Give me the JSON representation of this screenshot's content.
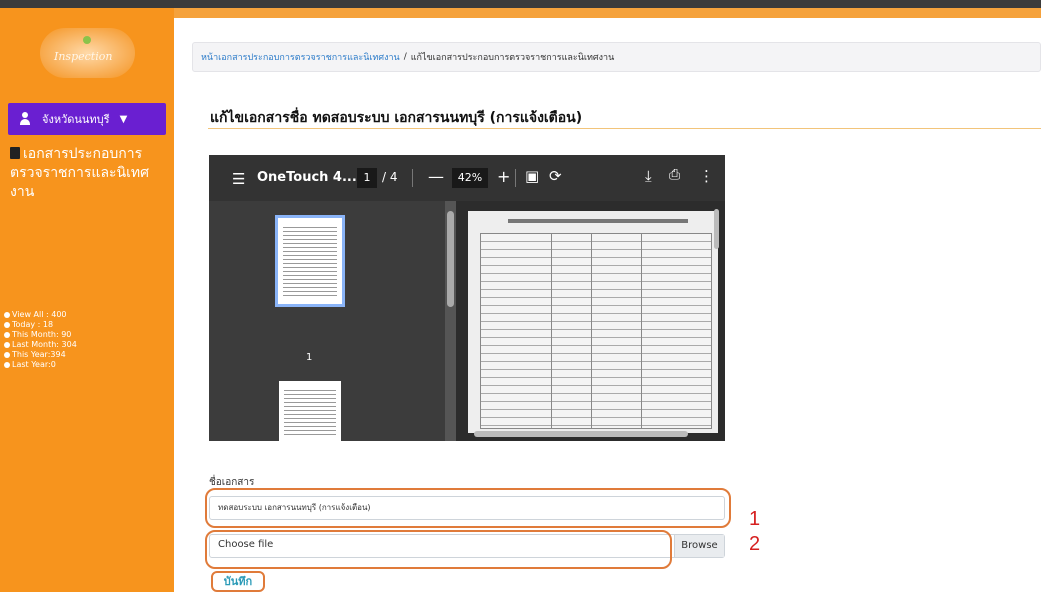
{
  "sidebar": {
    "logo_text": "Inspection",
    "province_label": "จังหวัดนนทบุรี",
    "menu_item_label": "เอกสารประกอบการตรวจราชการและนิเทศงาน",
    "stats": [
      "View All : 400",
      "Today : 18",
      "This Month: 90",
      "Last Month: 304",
      "This Year:394",
      "Last Year:0"
    ]
  },
  "breadcrumb": {
    "home": "หน้าเอกสารประกอบการตรวจราชการและนิเทศงาน",
    "separator": "/",
    "current": "แก้ไขเอกสารประกอบการตรวจราชการและนิเทศงาน"
  },
  "page_title": "แก้ไขเอกสารชื่อ ทดสอบระบบ เอกสารนนทบุรี (การแจ้งเตือน)",
  "viewer": {
    "file_title": "OneTouch 4....",
    "current_page": "1",
    "total_pages": "/ 4",
    "zoom": "42%",
    "thumb_label": "1"
  },
  "form": {
    "name_label": "ชื่อเอกสาร",
    "name_value": "ทดสอบระบบ เอกสารนนทบุรี (การแจ้งเตือน)",
    "file_placeholder": "Choose file",
    "browse_label": "Browse",
    "save_label": "บันทึก"
  },
  "annotations": [
    "1",
    "2"
  ],
  "colors": {
    "sidebar": "#f7941d",
    "province_bg": "#6a1fd1",
    "highlight": "#e07b3a",
    "annotation": "#d62020"
  }
}
